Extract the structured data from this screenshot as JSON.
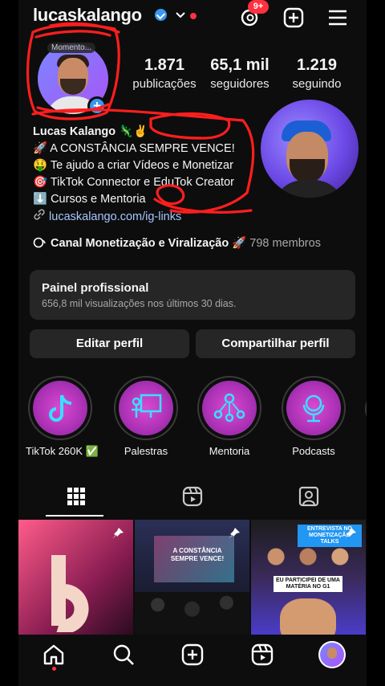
{
  "header": {
    "username": "lucaskalango",
    "threads_badge": "9+"
  },
  "profile": {
    "note": "Momento...",
    "stats": [
      {
        "value": "1.871",
        "label": "publicações"
      },
      {
        "value": "65,1 mil",
        "label": "seguidores"
      },
      {
        "value": "1.219",
        "label": "seguindo"
      }
    ],
    "display_name": "Lucas Kalango 🦎✌️",
    "bio_lines": [
      "🚀 A CONSTÂNCIA SEMPRE VENCE!",
      "🤑 Te ajudo a criar Vídeos e Monetizar",
      "🎯 TikTok Connector e EduTok Creator",
      "⬇️ Cursos e Mentoria"
    ],
    "link": "lucaskalango.com/ig-links",
    "channel": {
      "name": "Canal Monetização e Viralização 🚀",
      "members": "798 membros"
    }
  },
  "professional_panel": {
    "title": "Painel profissional",
    "subtitle": "656,8 mil visualizações nos últimos 30 dias."
  },
  "actions": {
    "edit": "Editar perfil",
    "share": "Compartilhar perfil"
  },
  "highlights": [
    {
      "label": "TikTok 260K ✅",
      "icon": "tiktok-icon"
    },
    {
      "label": "Palestras",
      "icon": "presentation-icon"
    },
    {
      "label": "Mentoria",
      "icon": "people-network-icon"
    },
    {
      "label": "Podcasts",
      "icon": "microphone-icon"
    }
  ],
  "tabs": [
    {
      "name": "grid-icon",
      "active": true
    },
    {
      "name": "reels-icon",
      "active": false
    },
    {
      "name": "tagged-icon",
      "active": false
    }
  ],
  "posts": {
    "p2_text": "A CONSTÂNCIA SEMPRE VENCE!",
    "p3_tag": "ENTREVISTA NO MONETIZAÇÃO TALKS",
    "p3_tag2": "EU PARTICIPEI DE UMA MATÉRIA NO G1"
  },
  "colors": {
    "accent": "#3897f0",
    "notification": "#ff3040",
    "link": "#a6c8ff",
    "panel": "#262626"
  }
}
